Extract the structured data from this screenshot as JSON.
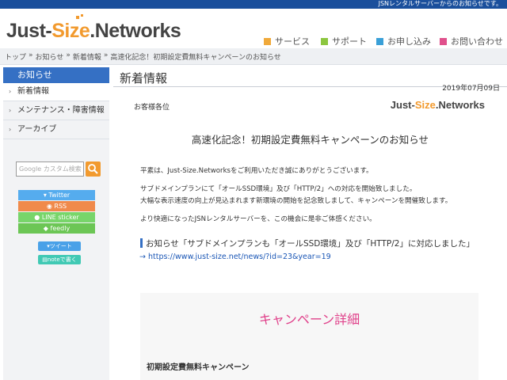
{
  "topbar": {
    "text": "JSNレンタルサーバーからのお知らせです。"
  },
  "header": {
    "logo": {
      "part1": "Just-",
      "part2": "Size",
      "part3": ".Networks"
    },
    "nav": [
      {
        "label": "サービス",
        "color": "#f0a93a"
      },
      {
        "label": "サポート",
        "color": "#8cc63f"
      },
      {
        "label": "お申し込み",
        "color": "#3aa0d8"
      },
      {
        "label": "お問い合わせ",
        "color": "#e0508c"
      }
    ]
  },
  "breadcrumb": [
    "トップ",
    "お知らせ",
    "新着情報",
    "高速化記念！初期設定費無料キャンペーンのお知らせ"
  ],
  "breadcrumb_sep": "»",
  "sidebar": {
    "heading": "お知らせ",
    "items": [
      {
        "label": "新着情報"
      },
      {
        "label": "メンテナンス・障害情報"
      },
      {
        "label": "アーカイブ"
      }
    ],
    "search_placeholder": "Google カスタム検索",
    "social": [
      {
        "label": "Twitter",
        "color": "#55acee"
      },
      {
        "label": "RSS",
        "color": "#f08a4b"
      },
      {
        "label": "LINE sticker",
        "color": "#78d56a"
      },
      {
        "label": "feedly",
        "color": "#6cc655"
      }
    ],
    "tweet_label": "ツイート",
    "note_label": "noteで書く"
  },
  "main": {
    "title": "新着情報",
    "date": "2019年07月09日",
    "greeting": "お客様各位",
    "mini_logo": {
      "part1": "Just-",
      "part2": "Size",
      "part3": ".Networks"
    },
    "headline": "高速化記念！初期設定費無料キャンペーンのお知らせ",
    "paragraphs": [
      "平素は、Just-Size.Networksをご利用いただき誠にありがとうございます。",
      "サブドメインプランにて「オールSSD環境」及び「HTTP/2」への対応を開始致しました。",
      "大幅な表示速度の向上が見込まれます新環境の開始を記念致しまして、キャンペーンを開催致します。",
      "より快適になったJSNレンタルサーバーを、この機会に是非ご体感ください。"
    ],
    "notice_title": "お知らせ「サブドメインプランも「オールSSD環境」及び「HTTP/2」に対応しました」",
    "notice_link": "→ https://www.just-size.net/news/?id=23&year=19",
    "campaign_title": "キャンペーン詳細",
    "campaign_sub": "初期設定費無料キャンペーン"
  },
  "colors": {
    "accent": "#f29a2e",
    "brand_blue": "#3570c4",
    "campaign_pink": "#e0408a"
  }
}
